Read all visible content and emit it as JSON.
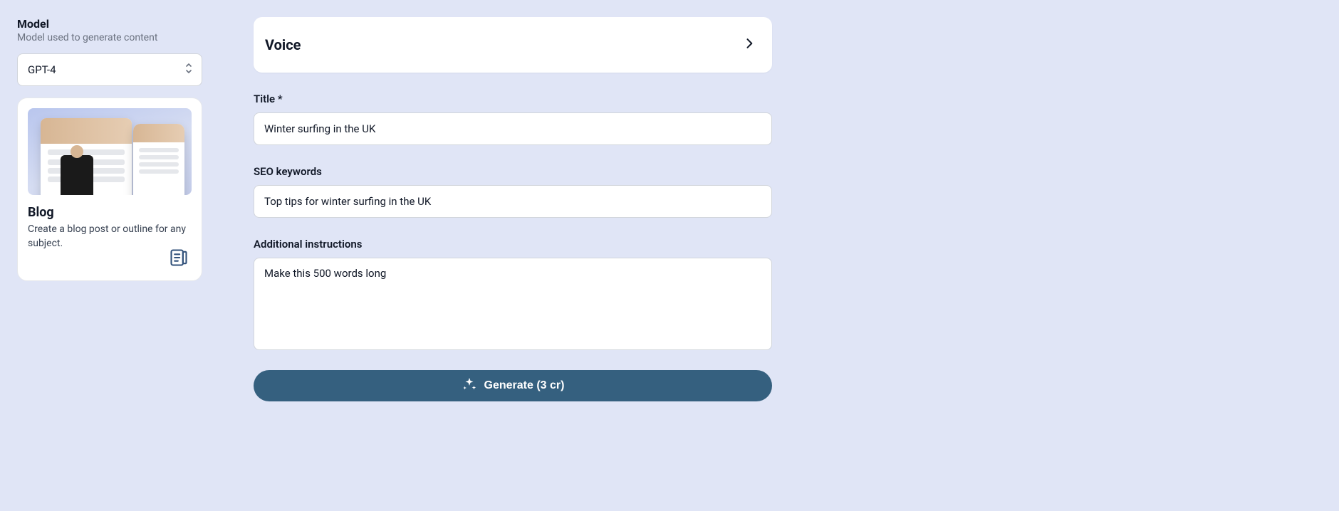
{
  "sidebar": {
    "model_heading": "Model",
    "model_sub": "Model used to generate content",
    "model_selected": "GPT-4",
    "template": {
      "title": "Blog",
      "desc": "Create a blog post or outline for any subject."
    }
  },
  "voice": {
    "label": "Voice"
  },
  "fields": {
    "title_label": "Title *",
    "title_value": "Winter surfing in the UK",
    "seo_label": "SEO keywords",
    "seo_value": "Top tips for winter surfing in the UK",
    "instructions_label": "Additional instructions",
    "instructions_value": "Make this 500 words long"
  },
  "generate": {
    "label": "Generate (3 cr)"
  }
}
